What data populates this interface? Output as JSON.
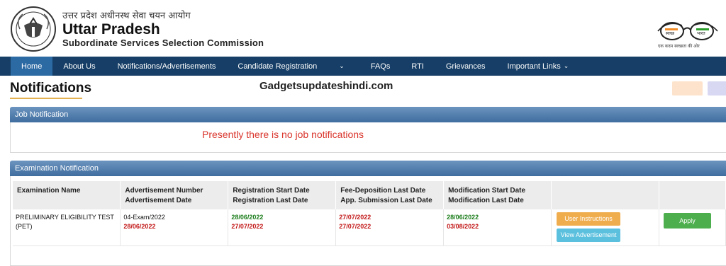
{
  "header": {
    "hindi_title": "उत्तर प्रदेश अधीनस्थ सेवा चयन आयोग",
    "org_name": "Uttar Pradesh",
    "org_subtitle": "Subordinate Services Selection Commission",
    "swachh_tagline": "एक कदम स्वच्छता की ओर",
    "swachh_left": "स्वच्छ",
    "swachh_right": "भारत"
  },
  "nav": {
    "items": [
      {
        "label": "Home",
        "active": true
      },
      {
        "label": "About Us"
      },
      {
        "label": "Notifications/Advertisements"
      },
      {
        "label": "Candidate Registration"
      },
      {
        "label": ""
      },
      {
        "label": "FAQs"
      },
      {
        "label": "RTI"
      },
      {
        "label": "Grievances"
      },
      {
        "label": "Important Links"
      }
    ],
    "chevron": "⌄"
  },
  "page": {
    "title": "Notifications",
    "watermark": "Gadgetsupdateshindi.com"
  },
  "job_panel": {
    "heading": "Job Notification",
    "empty_message": "Presently there is no job notifications"
  },
  "exam_panel": {
    "heading": "Examination Notification",
    "columns": [
      {
        "line1": "Examination Name",
        "line2": ""
      },
      {
        "line1": "Advertisement Number",
        "line2": "Advertisement Date"
      },
      {
        "line1": "Registration Start Date",
        "line2": "Registration Last Date"
      },
      {
        "line1": "Fee-Deposition Last Date",
        "line2": "App. Submission Last Date"
      },
      {
        "line1": "Modification Start Date",
        "line2": "Modification Last Date"
      },
      {
        "line1": "",
        "line2": ""
      },
      {
        "line1": "",
        "line2": ""
      }
    ],
    "rows": [
      {
        "exam_name": "PRELIMINARY ELIGIBILITY TEST (PET)",
        "adv_number": "04-Exam/2022",
        "adv_date": "28/06/2022",
        "reg_start": "28/06/2022",
        "reg_last": "27/07/2022",
        "fee_last": "27/07/2022",
        "app_last": "27/07/2022",
        "mod_start": "28/06/2022",
        "mod_last": "03/08/2022",
        "btn_instructions": "User Instructions",
        "btn_view_adv": "View Advertisement",
        "btn_apply": "Apply"
      }
    ]
  },
  "colors": {
    "nav_bg": "#163e66",
    "nav_active": "#2c6aa3",
    "panel_head": "#4f7cac",
    "alert_red": "#d9342b",
    "date_green": "#1b7d1b",
    "date_red": "#c31818",
    "btn_orange": "#f0ad4e",
    "btn_blue": "#5bc0de",
    "btn_green": "#4cae4c"
  }
}
